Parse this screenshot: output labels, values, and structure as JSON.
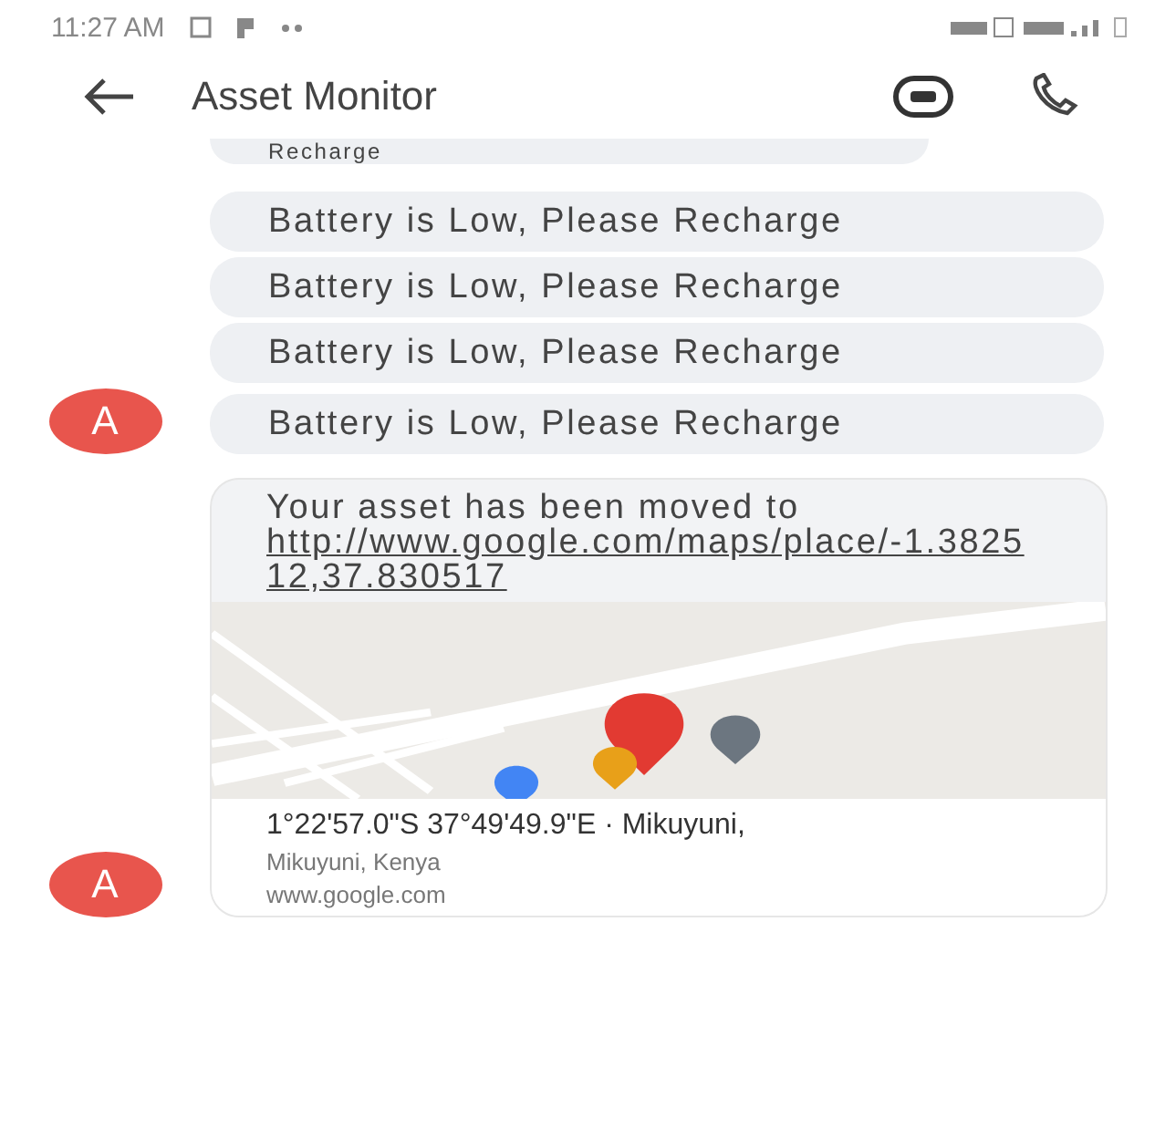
{
  "status_bar": {
    "time": "11:27 AM"
  },
  "header": {
    "title": "Asset Monitor"
  },
  "messages": [
    {
      "kind": "text",
      "text": "Recharge"
    },
    {
      "kind": "text",
      "text": "Battery is Low, Please Recharge"
    },
    {
      "kind": "text",
      "text": "Battery is Low, Please Recharge"
    },
    {
      "kind": "text",
      "text": "Battery is Low, Please Recharge"
    },
    {
      "kind": "text",
      "text": "Battery is Low, Please Recharge",
      "avatar": "A"
    },
    {
      "kind": "location",
      "text": "Your asset has been moved to",
      "link": "http://www.google.com/maps/place/-1.382512,37.830517",
      "address": "1°22'57.0\"S 37°49'49.9\"E · Mikuyuni,",
      "address_line_2": "Mikuyuni, Kenya",
      "site": "www.google.com",
      "avatar": "A"
    }
  ]
}
